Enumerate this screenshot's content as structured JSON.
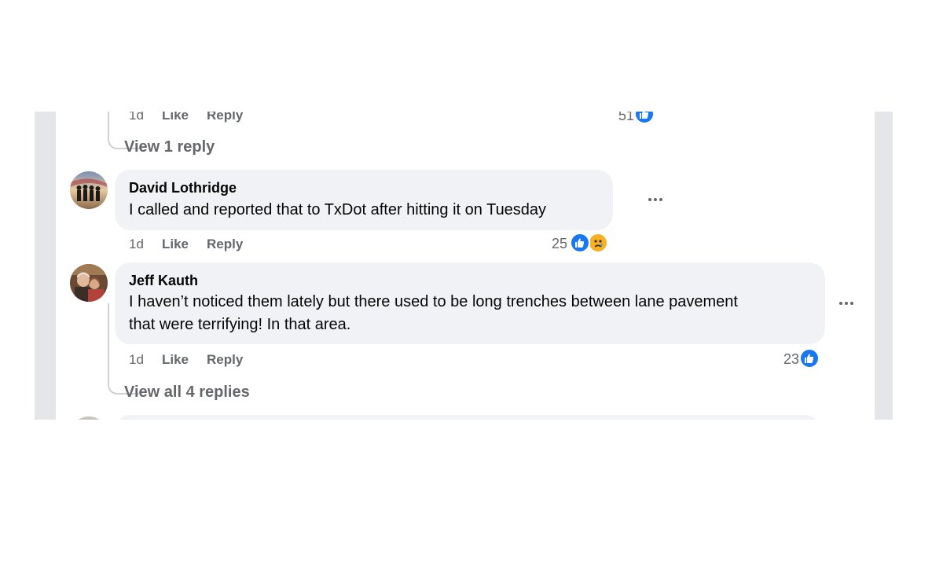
{
  "top_comment": {
    "time": "1d",
    "like_label": "Like",
    "reply_label": "Reply",
    "reaction_count": "51",
    "view_replies": "View 1 reply"
  },
  "comments": [
    {
      "author": "David Lothridge",
      "text": "I called and reported that to TxDot after hitting it on Tuesday",
      "time": "1d",
      "like_label": "Like",
      "reply_label": "Reply",
      "reaction_count": "25",
      "reactions": [
        "like-icon",
        "sad-icon"
      ]
    },
    {
      "author": "Jeff Kauth",
      "text_line1": "I haven’t noticed them lately but there used to be long trenches between lane pavement",
      "text_line2": "that were terrifying! In that area.",
      "time": "1d",
      "like_label": "Like",
      "reply_label": "Reply",
      "reaction_count": "23",
      "reactions": [
        "like-icon"
      ],
      "view_replies": "View all 4 replies"
    }
  ],
  "colors": {
    "link": "#65676b",
    "bubble": "#f0f2f5",
    "like_blue": "#1877f2",
    "sad_yellow": "#f7b125"
  }
}
